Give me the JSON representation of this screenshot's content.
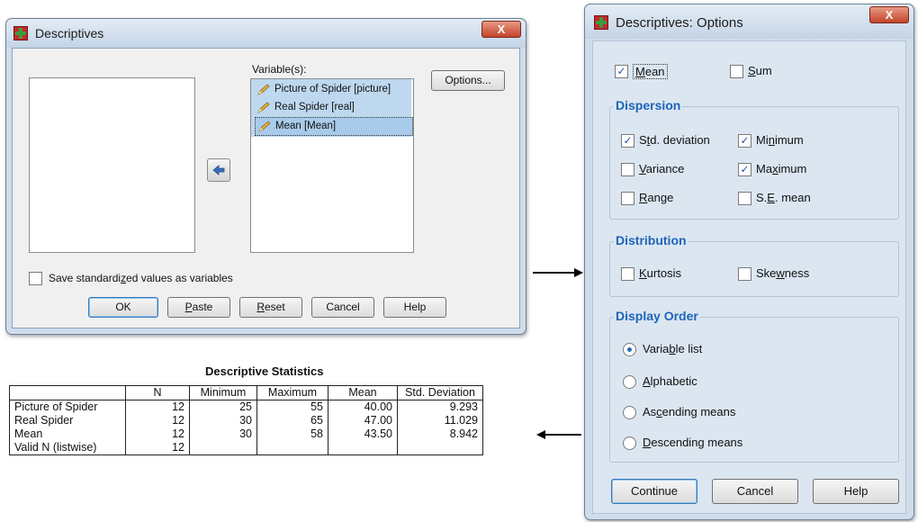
{
  "descriptives_dialog": {
    "title": "Descriptives",
    "close_label": "X",
    "variables_label": "Variable(s):",
    "variables": [
      "Picture of Spider [picture]",
      "Real Spider [real]",
      "Mean [Mean]"
    ],
    "options_button": "Options...",
    "save_standardized_label": "Save standardized values as variables",
    "save_standardized_checked": false,
    "buttons": {
      "ok": "OK",
      "paste": "Paste",
      "reset": "Reset",
      "cancel": "Cancel",
      "help": "Help"
    }
  },
  "options_dialog": {
    "title": "Descriptives: Options",
    "close_label": "X",
    "mean": {
      "label": "Mean",
      "checked": true
    },
    "sum": {
      "label": "Sum",
      "checked": false
    },
    "dispersion": {
      "title": "Dispersion",
      "std_deviation": {
        "label": "Std. deviation",
        "checked": true
      },
      "minimum": {
        "label": "Minimum",
        "checked": true
      },
      "variance": {
        "label": "Variance",
        "checked": false
      },
      "maximum": {
        "label": "Maximum",
        "checked": true
      },
      "range": {
        "label": "Range",
        "checked": false
      },
      "se_mean": {
        "label": "S.E. mean",
        "checked": false
      }
    },
    "distribution": {
      "title": "Distribution",
      "kurtosis": {
        "label": "Kurtosis",
        "checked": false
      },
      "skewness": {
        "label": "Skewness",
        "checked": false
      }
    },
    "display_order": {
      "title": "Display Order",
      "options": [
        "Variable list",
        "Alphabetic",
        "Ascending means",
        "Descending means"
      ],
      "selected": "Variable list"
    },
    "buttons": {
      "continue": "Continue",
      "cancel": "Cancel",
      "help": "Help"
    }
  },
  "output_table": {
    "title": "Descriptive Statistics",
    "headers": [
      "",
      "N",
      "Minimum",
      "Maximum",
      "Mean",
      "Std. Deviation"
    ],
    "rows": [
      [
        "Picture of Spider",
        "12",
        "25",
        "55",
        "40.00",
        "9.293"
      ],
      [
        "Real Spider",
        "12",
        "30",
        "65",
        "47.00",
        "11.029"
      ],
      [
        "Mean",
        "12",
        "30",
        "58",
        "43.50",
        "8.942"
      ],
      [
        "Valid N (listwise)",
        "12",
        "",
        "",
        "",
        ""
      ]
    ]
  },
  "colors": {
    "group_title": "#1e64b7",
    "checkmark": "#2b55a5",
    "variable_list_bg": "#bdd8ef"
  }
}
